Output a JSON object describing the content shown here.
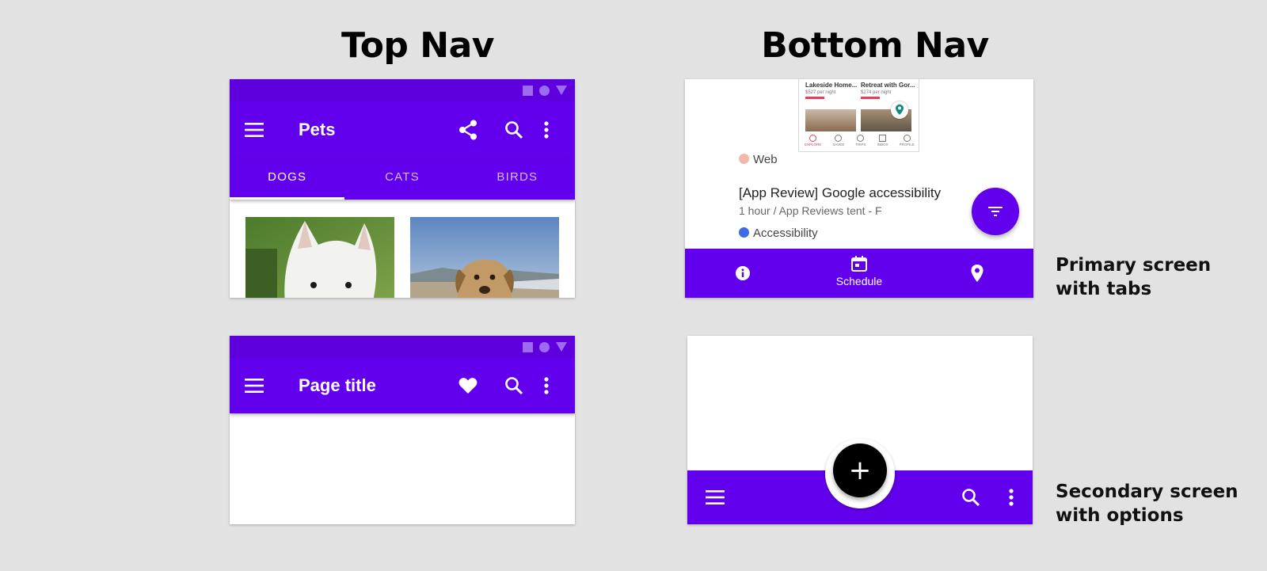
{
  "headings": {
    "top": "Top Nav",
    "bottom": "Bottom Nav"
  },
  "labels": {
    "primary_line1": "Primary screen",
    "primary_line2": "with tabs",
    "secondary_line1": "Secondary screen",
    "secondary_line2": "with options"
  },
  "top_primary": {
    "title": "Pets",
    "tabs": [
      {
        "label": "DOGS",
        "active": true
      },
      {
        "label": "CATS",
        "active": false
      },
      {
        "label": "BIRDS",
        "active": false
      }
    ],
    "icons": [
      "menu-icon",
      "share-icon",
      "search-icon",
      "more-vert-icon"
    ]
  },
  "top_secondary": {
    "title": "Page title",
    "icons": [
      "menu-icon",
      "heart-icon",
      "search-icon",
      "more-vert-icon"
    ]
  },
  "bottom_primary": {
    "thumb_items": [
      "Lakeside Home...",
      "Retreat with Gor..."
    ],
    "thumb_prices": [
      "$527 per night",
      "$274 per night"
    ],
    "thumb_tabs": [
      "EXPLORE",
      "SAVED",
      "TRIPS",
      "INBOX",
      "PROFILE"
    ],
    "tag_web": "Web",
    "event_title": "[App Review] Google accessibility",
    "event_sub": "1 hour / App Reviews tent - F",
    "tag_accessibility": "Accessibility",
    "nav_active_label": "Schedule",
    "icons": [
      "info-icon",
      "calendar-icon",
      "location-pin-icon",
      "filter-icon"
    ]
  },
  "bottom_secondary": {
    "fab_symbol": "+",
    "icons": [
      "menu-icon",
      "search-icon",
      "more-vert-icon"
    ]
  },
  "colors": {
    "primary": "#6200ee",
    "status": "#5e00de",
    "web_tag": "#f2b9a8",
    "accessibility_tag": "#3f6ae6",
    "fab_dark": "#000000"
  }
}
